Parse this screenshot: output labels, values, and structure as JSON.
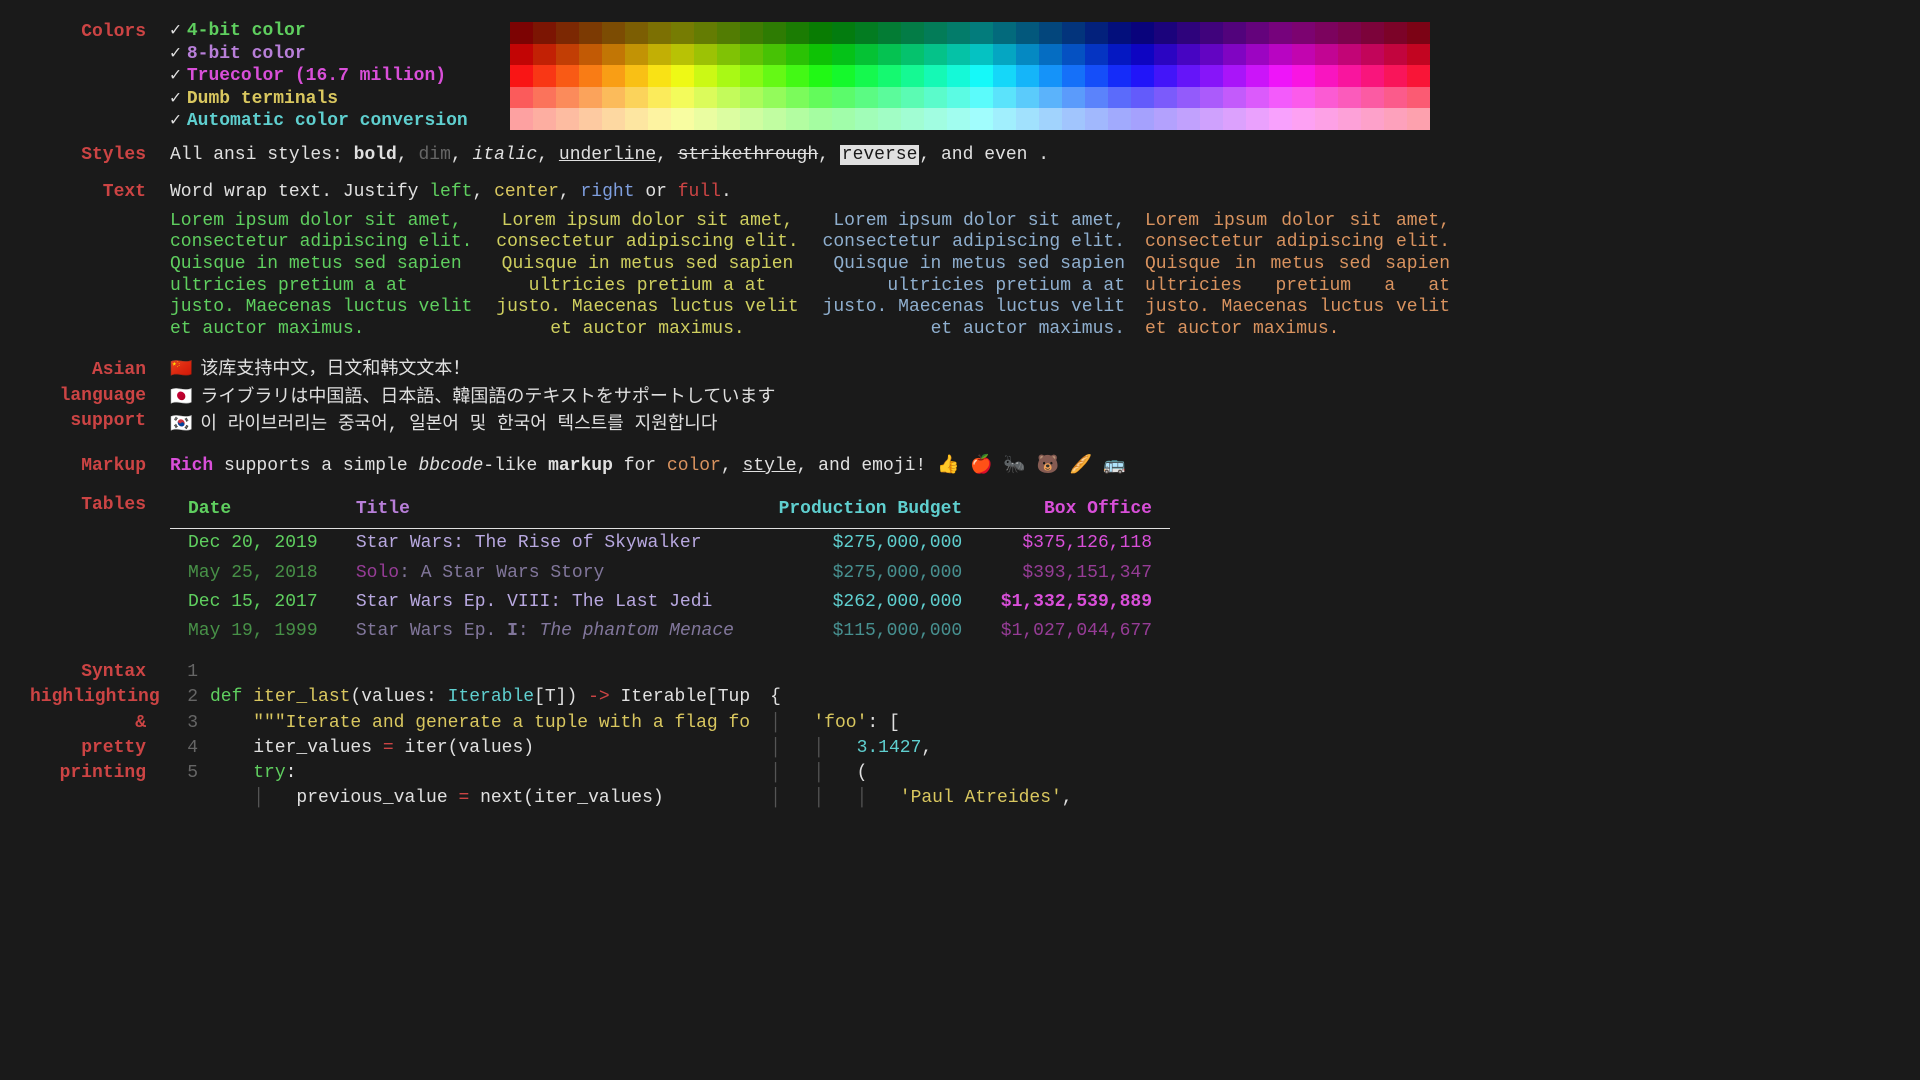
{
  "labels": {
    "colors": "Colors",
    "styles": "Styles",
    "text": "Text",
    "asian": "Asian\\nlanguage\\nsupport",
    "markup": "Markup",
    "tables": "Tables",
    "syntax": "Syntax\\nhighlighting\\n&\\npretty\\nprinting"
  },
  "colors": {
    "items": [
      "4-bit color",
      "8-bit color",
      "Truecolor (16.7 million)",
      "Dumb terminals",
      "Automatic color conversion"
    ]
  },
  "styles": {
    "prefix": "All ansi styles: ",
    "bold": "bold",
    "dim": "dim",
    "italic": "italic",
    "underline": "underline",
    "strike": "strikethrough",
    "reverse": "reverse",
    "suffix": ", and even       ."
  },
  "text": {
    "line1a": "Word wrap text. Justify ",
    "left": "left",
    "center": "center",
    "right": "right",
    "or": " or ",
    "full": "full",
    "period": ".",
    "lorem": "Lorem ipsum dolor sit amet, consectetur adipiscing elit. Quisque in metus sed sapien ultricies pretium a at justo. Maecenas luctus velit et auctor maximus."
  },
  "asian": {
    "cn": "该库支持中文，日文和韩文文本！",
    "jp": "ライブラリは中国語、日本語、韓国語のテキストをサポートしています",
    "kr": "이 라이브러리는 중국어, 일본어 및 한국어 텍스트를 지원합니다"
  },
  "markup": {
    "rich": "Rich",
    "sup": " supports a simple ",
    "bbcode": "bbcode",
    "like": "-like ",
    "markup": "markup",
    "for": " for ",
    "color": "color",
    "style": "style",
    "emoji": ", and emoji! 👍 🍎 🐜 🐻 🥖 🚌"
  },
  "table": {
    "headers": [
      "Date",
      "Title",
      "Production Budget",
      "Box Office"
    ],
    "rows": [
      {
        "date": "Dec 20, 2019",
        "title": "Star Wars: The Rise of Skywalker",
        "budget": "$275,000,000",
        "box": "$375,126,118",
        "dim": false
      },
      {
        "date": "May 25, 2018",
        "title_a": "Solo",
        "title_b": ": A Star Wars Story",
        "budget": "$275,000,000",
        "box": "$393,151,347",
        "dim": true
      },
      {
        "date": "Dec 15, 2017",
        "title": "Star Wars Ep. VIII: The Last Jedi",
        "budget": "$262,000,000",
        "box": "$1,332,539,889",
        "dim": false,
        "boxbold": true
      },
      {
        "date": "May 19, 1999",
        "title_a": "Star Wars Ep. ",
        "title_b": "I",
        "title_c": ": ",
        "title_d": "The phantom Menace",
        "budget": "$115,000,000",
        "box": "$1,027,044,677",
        "dim": true
      }
    ]
  },
  "code": {
    "lines": [
      "1",
      "2",
      "3",
      "4",
      "5"
    ],
    "l1": {
      "a": "def ",
      "b": "iter_last",
      "c": "(values: ",
      "d": "Iterable",
      "e": "[T]) ",
      "f": "->",
      "g": " Iterable[Tup"
    },
    "l2": {
      "a": "    ",
      "b": "\"\"\"Iterate and generate a tuple with a flag fo"
    },
    "l3": {
      "a": "    iter_values ",
      "b": "=",
      "c": " iter(values)"
    },
    "l4": {
      "a": "    ",
      "b": "try",
      "c": ":"
    },
    "l5": {
      "a": "        previous_value ",
      "b": "=",
      "c": " next(iter_values)"
    }
  },
  "pretty": {
    "l1": "{",
    "l2a": "    ",
    "l2b": "'foo'",
    "l2c": ": [",
    "l3a": "        ",
    "l3b": "3.1427",
    "l3c": ",",
    "l4a": "        (",
    "l5a": "            ",
    "l5b": "'Paul Atreides'",
    "l5c": ","
  }
}
